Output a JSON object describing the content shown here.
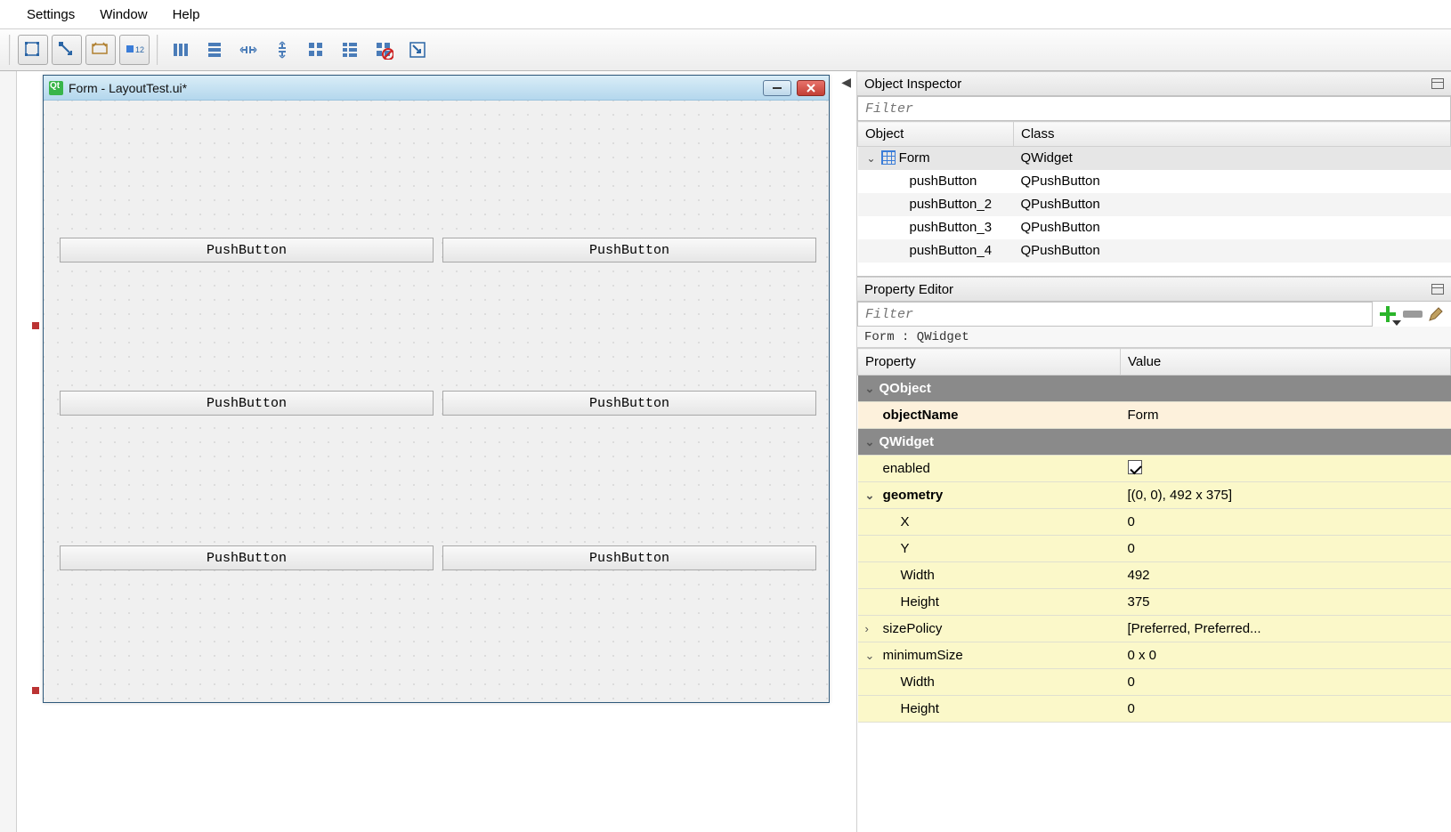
{
  "menubar": {
    "settings": "Settings",
    "window": "Window",
    "help": "Help"
  },
  "form": {
    "title": "Form - LayoutTest.ui*",
    "buttons": [
      "PushButton",
      "PushButton",
      "PushButton",
      "PushButton",
      "PushButton",
      "PushButton"
    ]
  },
  "objectInspector": {
    "title": "Object Inspector",
    "filter_placeholder": "Filter",
    "headers": {
      "object": "Object",
      "class": "Class"
    },
    "rows": [
      {
        "object": "Form",
        "class": "QWidget"
      },
      {
        "object": "pushButton",
        "class": "QPushButton"
      },
      {
        "object": "pushButton_2",
        "class": "QPushButton"
      },
      {
        "object": "pushButton_3",
        "class": "QPushButton"
      },
      {
        "object": "pushButton_4",
        "class": "QPushButton"
      }
    ]
  },
  "propertyEditor": {
    "title": "Property Editor",
    "filter_placeholder": "Filter",
    "context": "Form : QWidget",
    "headers": {
      "property": "Property",
      "value": "Value"
    },
    "groups": {
      "qobject": "QObject",
      "qwidget": "QWidget"
    },
    "props": {
      "objectName": {
        "label": "objectName",
        "value": "Form"
      },
      "enabled": {
        "label": "enabled"
      },
      "geometry": {
        "label": "geometry",
        "value": "[(0, 0), 492 x 375]"
      },
      "x": {
        "label": "X",
        "value": "0"
      },
      "y": {
        "label": "Y",
        "value": "0"
      },
      "width": {
        "label": "Width",
        "value": "492"
      },
      "height": {
        "label": "Height",
        "value": "375"
      },
      "sizePolicy": {
        "label": "sizePolicy",
        "value": "[Preferred, Preferred..."
      },
      "minimumSize": {
        "label": "minimumSize",
        "value": "0 x 0"
      },
      "minWidth": {
        "label": "Width",
        "value": "0"
      },
      "minHeight": {
        "label": "Height",
        "value": "0"
      }
    }
  }
}
